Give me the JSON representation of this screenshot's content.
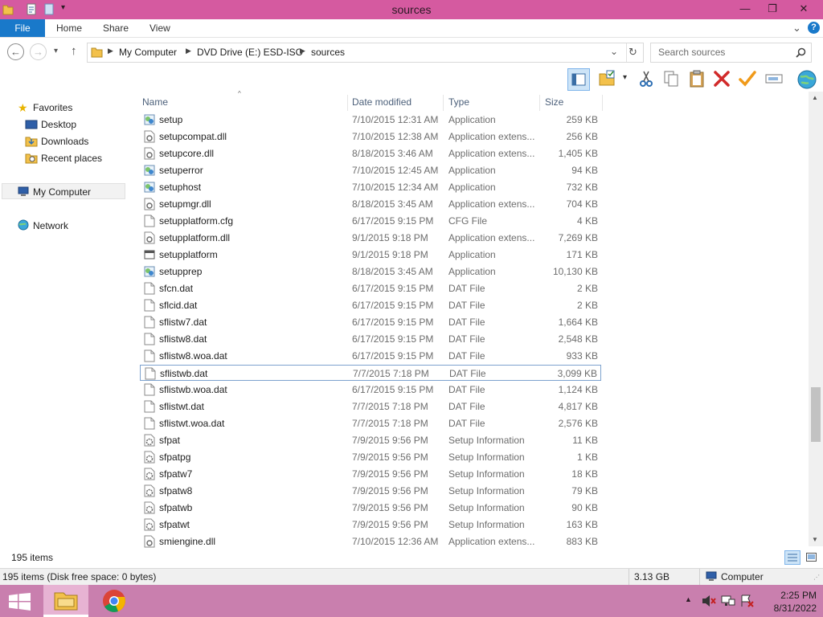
{
  "window": {
    "title": "sources",
    "minimize": "—",
    "maximize": "❐",
    "close": "✕"
  },
  "ribbon": {
    "tabs": [
      "File",
      "Home",
      "Share",
      "View"
    ],
    "collapse": "⌄",
    "help": "?"
  },
  "address": {
    "crumbs": [
      "My Computer",
      "DVD Drive (E:) ESD-ISO",
      "sources"
    ],
    "search_placeholder": "Search sources"
  },
  "nav": {
    "favorites": "Favorites",
    "desktop": "Desktop",
    "downloads": "Downloads",
    "recent": "Recent places",
    "computer": "My Computer",
    "network": "Network"
  },
  "columns": {
    "name": "Name",
    "date": "Date modified",
    "type": "Type",
    "size": "Size"
  },
  "files": [
    {
      "name": "setup",
      "date": "7/10/2015 12:31 AM",
      "type": "Application",
      "size": "259 KB",
      "icon": "setup-app-icon"
    },
    {
      "name": "setupcompat.dll",
      "date": "7/10/2015 12:38 AM",
      "type": "Application extens...",
      "size": "256 KB",
      "icon": "dll-icon"
    },
    {
      "name": "setupcore.dll",
      "date": "8/18/2015 3:46 AM",
      "type": "Application extens...",
      "size": "1,405 KB",
      "icon": "dll-icon"
    },
    {
      "name": "setuperror",
      "date": "7/10/2015 12:45 AM",
      "type": "Application",
      "size": "94 KB",
      "icon": "setup-app-icon"
    },
    {
      "name": "setuphost",
      "date": "7/10/2015 12:34 AM",
      "type": "Application",
      "size": "732 KB",
      "icon": "setup-app-icon"
    },
    {
      "name": "setupmgr.dll",
      "date": "8/18/2015 3:45 AM",
      "type": "Application extens...",
      "size": "704 KB",
      "icon": "dll-icon"
    },
    {
      "name": "setupplatform.cfg",
      "date": "6/17/2015 9:15 PM",
      "type": "CFG File",
      "size": "4 KB",
      "icon": "file-icon"
    },
    {
      "name": "setupplatform.dll",
      "date": "9/1/2015 9:18 PM",
      "type": "Application extens...",
      "size": "7,269 KB",
      "icon": "dll-icon"
    },
    {
      "name": "setupplatform",
      "date": "9/1/2015 9:18 PM",
      "type": "Application",
      "size": "171 KB",
      "icon": "window-app-icon"
    },
    {
      "name": "setupprep",
      "date": "8/18/2015 3:45 AM",
      "type": "Application",
      "size": "10,130 KB",
      "icon": "setup-app-icon"
    },
    {
      "name": "sfcn.dat",
      "date": "6/17/2015 9:15 PM",
      "type": "DAT File",
      "size": "2 KB",
      "icon": "file-icon"
    },
    {
      "name": "sflcid.dat",
      "date": "6/17/2015 9:15 PM",
      "type": "DAT File",
      "size": "2 KB",
      "icon": "file-icon"
    },
    {
      "name": "sflistw7.dat",
      "date": "6/17/2015 9:15 PM",
      "type": "DAT File",
      "size": "1,664 KB",
      "icon": "file-icon"
    },
    {
      "name": "sflistw8.dat",
      "date": "6/17/2015 9:15 PM",
      "type": "DAT File",
      "size": "2,548 KB",
      "icon": "file-icon"
    },
    {
      "name": "sflistw8.woa.dat",
      "date": "6/17/2015 9:15 PM",
      "type": "DAT File",
      "size": "933 KB",
      "icon": "file-icon"
    },
    {
      "name": "sflistwb.dat",
      "date": "7/7/2015 7:18 PM",
      "type": "DAT File",
      "size": "3,099 KB",
      "icon": "file-icon",
      "selected": true
    },
    {
      "name": "sflistwb.woa.dat",
      "date": "6/17/2015 9:15 PM",
      "type": "DAT File",
      "size": "1,124 KB",
      "icon": "file-icon"
    },
    {
      "name": "sflistwt.dat",
      "date": "7/7/2015 7:18 PM",
      "type": "DAT File",
      "size": "4,817 KB",
      "icon": "file-icon"
    },
    {
      "name": "sflistwt.woa.dat",
      "date": "7/7/2015 7:18 PM",
      "type": "DAT File",
      "size": "2,576 KB",
      "icon": "file-icon"
    },
    {
      "name": "sfpat",
      "date": "7/9/2015 9:56 PM",
      "type": "Setup Information",
      "size": "11 KB",
      "icon": "inf-icon"
    },
    {
      "name": "sfpatpg",
      "date": "7/9/2015 9:56 PM",
      "type": "Setup Information",
      "size": "1 KB",
      "icon": "inf-icon"
    },
    {
      "name": "sfpatw7",
      "date": "7/9/2015 9:56 PM",
      "type": "Setup Information",
      "size": "18 KB",
      "icon": "inf-icon"
    },
    {
      "name": "sfpatw8",
      "date": "7/9/2015 9:56 PM",
      "type": "Setup Information",
      "size": "79 KB",
      "icon": "inf-icon"
    },
    {
      "name": "sfpatwb",
      "date": "7/9/2015 9:56 PM",
      "type": "Setup Information",
      "size": "90 KB",
      "icon": "inf-icon"
    },
    {
      "name": "sfpatwt",
      "date": "7/9/2015 9:56 PM",
      "type": "Setup Information",
      "size": "163 KB",
      "icon": "inf-icon"
    },
    {
      "name": "smiengine.dll",
      "date": "7/10/2015 12:36 AM",
      "type": "Application extens...",
      "size": "883 KB",
      "icon": "dll-icon"
    }
  ],
  "status": {
    "items": "195 items",
    "detail": "195 items (Disk free space: 0 bytes)",
    "size": "3.13 GB",
    "location": "Computer"
  },
  "taskbar": {
    "time": "2:25 PM",
    "date": "8/31/2022",
    "tray_up": "▲"
  },
  "colors": {
    "titlebar": "#d55aa0",
    "taskbar": "#c97fae",
    "file_tab": "#1979ca",
    "selection_border": "#7da2ce"
  }
}
